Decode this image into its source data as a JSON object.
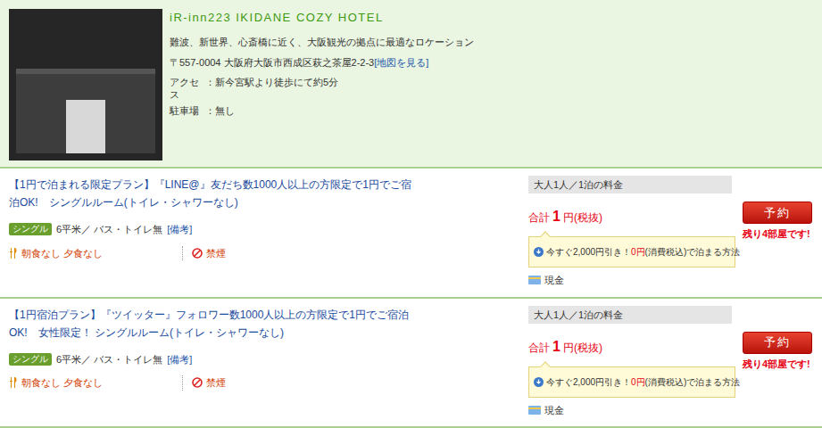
{
  "hotel": {
    "name": "iR-inn223 IKIDANE COZY HOTEL",
    "catch": "難波、新世界、心斎橋に近く、大阪観光の拠点に最適なロケーション",
    "address": "〒557-0004 大阪府大阪市西成区萩之茶屋2-2-3",
    "map_link": "[地図を見る]",
    "access_label": "アクセス",
    "access": "：新今宮駅より徒歩にて約5分",
    "parking_label": "駐車場",
    "parking": "：無し"
  },
  "plans": [
    {
      "title": "【1円で泊まれる限定プラン】『LINE@』友だち数1000人以上の方限定で1円でご宿泊OK!　シングルルーム(トイレ・シャワーなし)",
      "room_type": "シングル",
      "room_info": "6平米／ バス・トイレ無",
      "remarks": "[備考]",
      "meals": "朝食なし 夕食なし",
      "smoking": "禁煙",
      "price_header": "大人1人／1泊の料金",
      "total_label": "合計",
      "price": "1",
      "unit": "円(税抜)",
      "discount_pre": "今すぐ2,000円引き！",
      "discount_zero": "0円",
      "discount_post": "(消費税込)で泊まる方法",
      "payment": "現金",
      "reserve": "予約",
      "remaining": "残り4部屋です!"
    },
    {
      "title": "【1円宿泊プラン】『ツイッター』フォロワー数1000人以上の方限定で1円でご宿泊OK!　女性限定！ シングルルーム(トイレ・シャワーなし)",
      "room_type": "シングル",
      "room_info": "6平米／ バス・トイレ無",
      "remarks": "[備考]",
      "meals": "朝食なし 夕食なし",
      "smoking": "禁煙",
      "price_header": "大人1人／1泊の料金",
      "total_label": "合計",
      "price": "1",
      "unit": "円(税抜)",
      "discount_pre": "今すぐ2,000円引き！",
      "discount_zero": "0円",
      "discount_post": "(消費税込)で泊まる方法",
      "payment": "現金",
      "reserve": "予約",
      "remaining": "残り4部屋です!"
    }
  ]
}
